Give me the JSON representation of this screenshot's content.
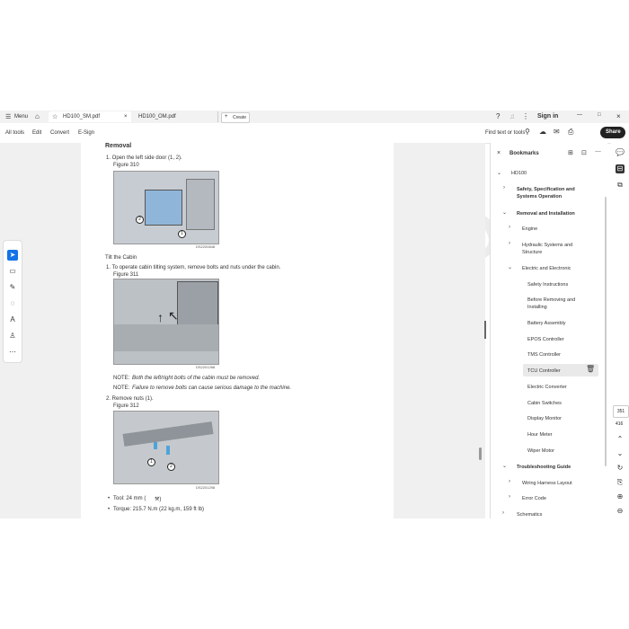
{
  "tabbar": {
    "menu_label": "Menu",
    "tab1": "HD100_SM.pdf",
    "tab2": "HD100_OM.pdf",
    "create_label": "Create",
    "signin": "Sign in"
  },
  "menubar": {
    "items": [
      "All tools",
      "Edit",
      "Convert",
      "E-Sign"
    ],
    "find_label": "Find text or tools",
    "share_label": "Share"
  },
  "document": {
    "section_title": "Removal",
    "step1": "1.  Open the left side door (1, 2).",
    "fig310_label": "Figure 310",
    "fig310_code": "DS2200848",
    "tilt_heading": "Tilt the Cabin",
    "step1b": "1.  To operate cabin tilting system, remove bolts and nuts under the cabin.",
    "fig311_label": "Figure 311",
    "fig311_code": "DS2201288",
    "note1_prefix": "NOTE:",
    "note1": "Both the left/right bolts of the cabin must be removed.",
    "note2_prefix": "NOTE:",
    "note2": "Failure to remove bolts can cause serious damage to the machine.",
    "step2": "2.  Remove nuts (1).",
    "fig312_label": "Figure 312",
    "fig312_code": "DS2201298",
    "bullet1": "Tool: 24 mm (",
    "bullet2": "Torque: 215.7 N.m (22 kg.m, 159 ft lb)"
  },
  "bookmarks": {
    "title": "Bookmarks",
    "root": "HD100",
    "safety": "Safety, Specification and",
    "safety2": "Systems Operation",
    "removal": "Removal and Installation",
    "engine": "Engine",
    "hydraulic": "Hydraulic Systems and",
    "hydraulic2": "Structure",
    "electric": "Electric and Electronic",
    "items": [
      "Safety Instructions",
      "Before Removing and",
      "Installing",
      "Battery Assembly",
      "EPOS Controller",
      "TMS Controller",
      "TCU Controller",
      "Electric Converter",
      "Cabin Switches",
      "Display Monitor",
      "Hour Meter",
      "Wiper Motor"
    ],
    "trouble": "Troubleshooting Guide",
    "wiring": "Wiring Harness Layout",
    "errorcode": "Error Code",
    "schematics": "Schematics"
  },
  "pager": {
    "current": "351",
    "total": "416"
  },
  "watermark": "ERADEPO.COM",
  "colors": {
    "accent": "#1473e6",
    "share_bg": "#222222"
  }
}
